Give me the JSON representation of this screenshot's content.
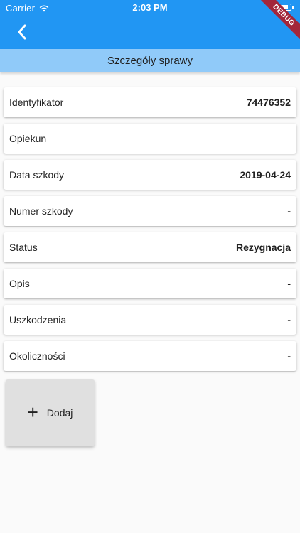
{
  "status_bar": {
    "carrier": "Carrier",
    "time": "2:03 PM"
  },
  "app_bar": {
    "back_icon": "chevron-left-icon",
    "debug_label": "DEBUG",
    "background_color": "#2196f3"
  },
  "subheader": {
    "title": "Szczegóły sprawy",
    "background_color": "#90caf9"
  },
  "details": [
    {
      "label": "Identyfikator",
      "value": "74476352"
    },
    {
      "label": "Opiekun",
      "value": ""
    },
    {
      "label": "Data szkody",
      "value": "2019-04-24"
    },
    {
      "label": "Numer szkody",
      "value": "-"
    },
    {
      "label": "Status",
      "value": "Rezygnacja"
    },
    {
      "label": "Opis",
      "value": "-"
    },
    {
      "label": "Uszkodzenia",
      "value": "-"
    },
    {
      "label": "Okoliczności",
      "value": "-"
    }
  ],
  "add_button": {
    "icon": "plus-icon",
    "label": "Dodaj"
  }
}
